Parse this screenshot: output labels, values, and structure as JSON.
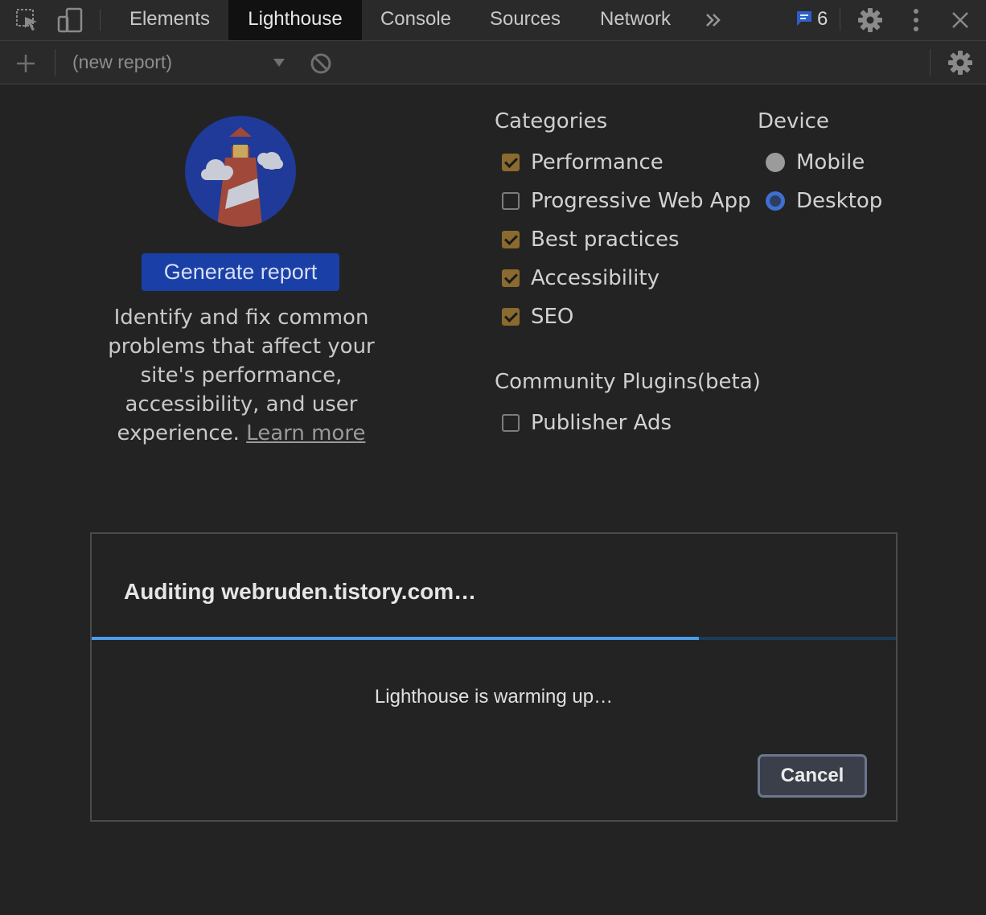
{
  "tabs": {
    "items": [
      {
        "label": "Elements"
      },
      {
        "label": "Lighthouse"
      },
      {
        "label": "Console"
      },
      {
        "label": "Sources"
      },
      {
        "label": "Network"
      }
    ],
    "active": "Lighthouse",
    "overflow_icon": "double-chevron-right-icon",
    "messages_count": "6",
    "icons": [
      "inspect-element-icon",
      "device-toolbar-icon",
      "messages-icon",
      "settings-icon",
      "more-vertical-icon",
      "close-icon"
    ]
  },
  "toolbar": {
    "report_selector": "(new report)",
    "icons": [
      "add-icon",
      "dropdown-arrow-icon",
      "clear-icon",
      "settings-icon"
    ]
  },
  "intro": {
    "generate_label": "Generate report",
    "description": "Identify and fix common problems that affect your site's performance, accessibility, and user experience.",
    "learn_more": "Learn more"
  },
  "categories": {
    "title": "Categories",
    "items": [
      {
        "label": "Performance",
        "checked": true
      },
      {
        "label": "Progressive Web App",
        "checked": false
      },
      {
        "label": "Best practices",
        "checked": true
      },
      {
        "label": "Accessibility",
        "checked": true
      },
      {
        "label": "SEO",
        "checked": true
      }
    ]
  },
  "plugins": {
    "title": "Community Plugins(beta)",
    "items": [
      {
        "label": "Publisher Ads",
        "checked": false
      }
    ]
  },
  "device": {
    "title": "Device",
    "options": [
      {
        "label": "Mobile",
        "selected": false
      },
      {
        "label": "Desktop",
        "selected": true
      }
    ]
  },
  "dialog": {
    "title": "Auditing webruden.tistory.com…",
    "status": "Lighthouse is warming up…",
    "progress": 0.755,
    "cancel_label": "Cancel"
  },
  "colors": {
    "accent_blue": "#1a3fa6",
    "checkbox_on": "#8a6a2e",
    "progress": "#4b9de8"
  }
}
